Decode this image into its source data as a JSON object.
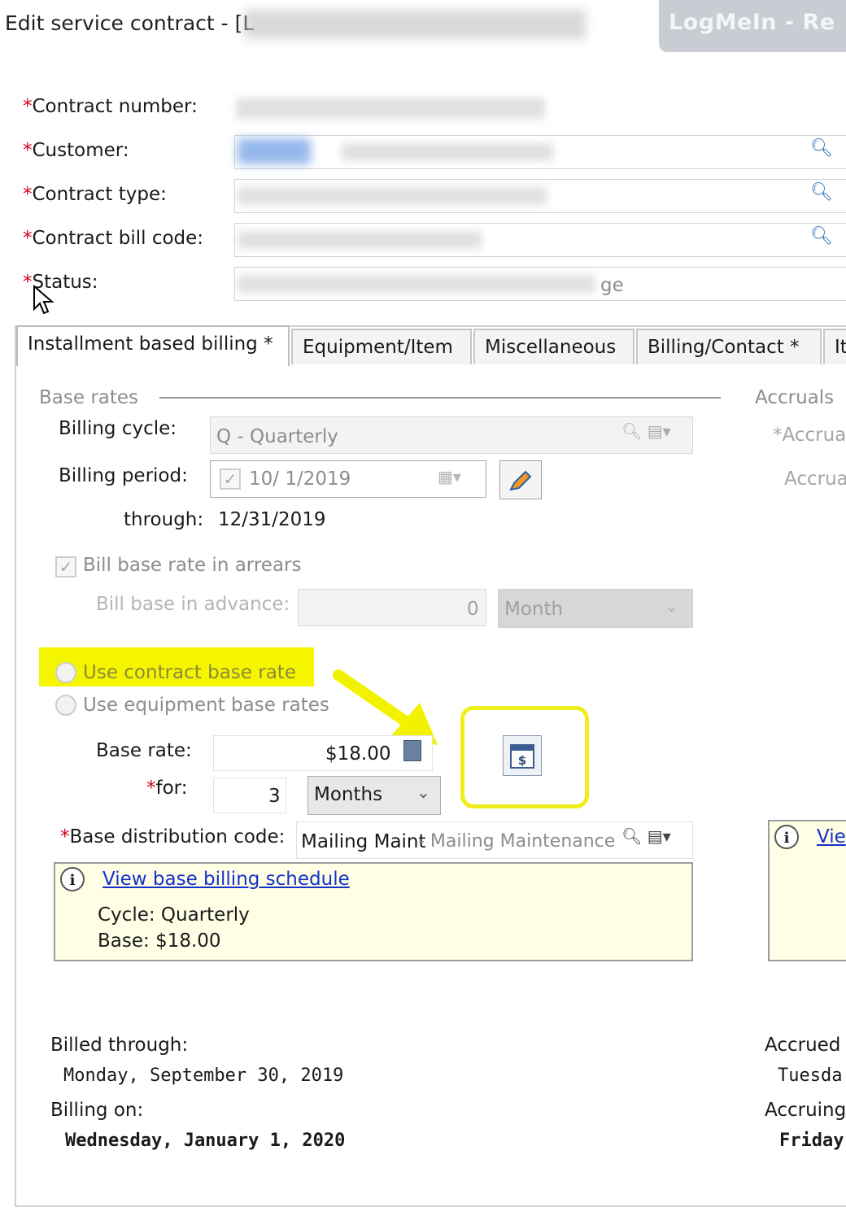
{
  "window": {
    "title": "Edit service contract - [L",
    "remote_app": "LogMeIn - Re"
  },
  "header_fields": {
    "contract_number_label": "Contract number:",
    "customer_label": "Customer:",
    "contract_type_label": "Contract type:",
    "contract_bill_code_label": "Contract bill code:",
    "status_label": "Status:",
    "status_value_fragment": "ge",
    "required_mark": "*"
  },
  "tabs": [
    {
      "label": "Installment based billing *"
    },
    {
      "label": "Equipment/Item"
    },
    {
      "label": "Miscellaneous"
    },
    {
      "label": "Billing/Contact *"
    },
    {
      "label": "It"
    }
  ],
  "base_rates": {
    "section_title": "Base rates",
    "billing_cycle_label": "Billing cycle:",
    "billing_cycle_value": "Q - Quarterly",
    "billing_period_label": "Billing period:",
    "billing_period_value": "10/  1/2019",
    "through_label": "through:",
    "through_value": "12/31/2019",
    "bill_arrears_label": "Bill base rate in arrears",
    "bill_advance_label": "Bill base in advance:",
    "bill_advance_value": "0",
    "bill_advance_unit": "Month",
    "use_contract_rate_label": "Use contract base rate",
    "use_equipment_rates_label": "Use equipment base rates",
    "base_rate_label": "Base rate:",
    "base_rate_value": "$18.00",
    "for_label": "for:",
    "for_value": "3",
    "for_unit": "Months",
    "distribution_label": "Base distribution code:",
    "distribution_code": "Mailing Maint",
    "distribution_desc": "- Mailing Maintenance",
    "schedule_link": "View base billing schedule",
    "schedule_cycle": "Cycle: Quarterly",
    "schedule_base": "Base: $18.00"
  },
  "accruals": {
    "section_title": "Accruals",
    "field1_label": "*Accrua",
    "field2_label": "Accrua",
    "link_fragment": "Vie"
  },
  "footer": {
    "billed_through_label": "Billed through:",
    "billed_through_value": "Monday, September 30, 2019",
    "billing_on_label": "Billing on:",
    "billing_on_value": "Wednesday, January 1, 2020",
    "accrued_label": "Accrued",
    "accrued_value": "Tuesda",
    "accruing_label": "Accruing",
    "accruing_value": "Friday,"
  },
  "colors": {
    "highlight_yellow": "#f6f500",
    "link_blue": "#1530c8",
    "required_red": "#d0021b",
    "info_bg": "#ffffe6"
  }
}
